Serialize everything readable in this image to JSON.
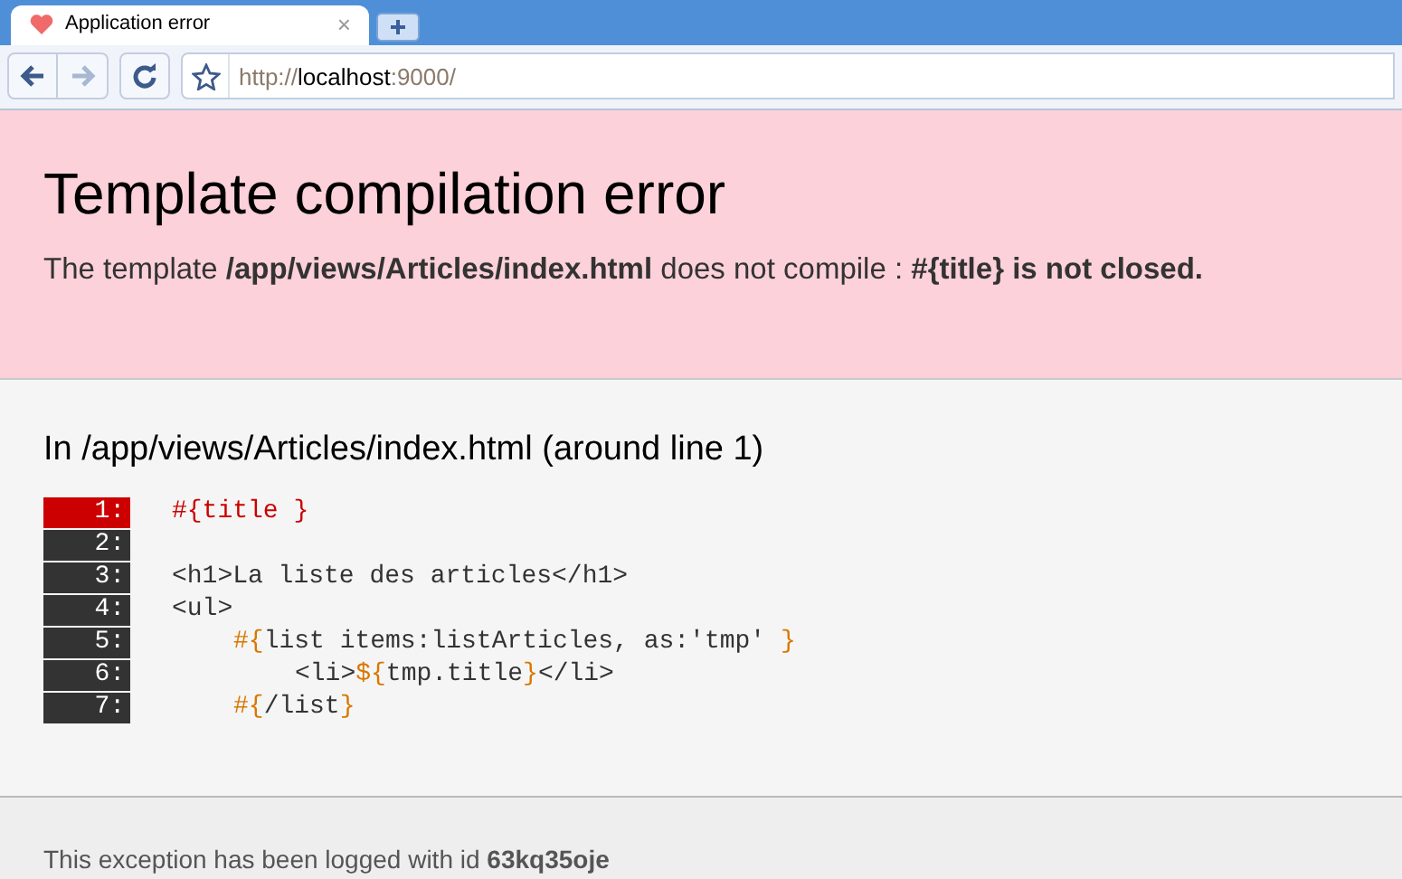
{
  "tab": {
    "title": "Application error",
    "close": "×",
    "selected": true
  },
  "url": [
    {
      "kind": "dim",
      "text": "http://"
    },
    {
      "kind": "host",
      "text": "localhost"
    },
    {
      "kind": "dim",
      "text": ":9000/"
    }
  ],
  "header": {
    "title": "Template compilation error",
    "message": "The template **/app/views/Articles/index.html** does not compile : **#{title} is not closed.**"
  },
  "source": {
    "title": "In /app/views/Articles/index.html (around line 1)",
    "lines": [
      {
        "number": "1:",
        "error": true,
        "segments": [
          {
            "kind": "tag",
            "text": "#{title }"
          }
        ]
      },
      {
        "number": "2:",
        "error": false
      },
      {
        "number": "3:",
        "error": false,
        "segments": [
          {
            "kind": "text",
            "text": "<h1>La liste des articles</h1>"
          }
        ]
      },
      {
        "number": "4:",
        "error": false,
        "segments": [
          {
            "kind": "text",
            "text": "<ul>"
          }
        ],
        "children": [
          {
            "number": "5:",
            "error": false,
            "segments": [
              {
                "kind": "tag",
                "text": "#{"
              },
              {
                "kind": "text",
                "text": "list items:listArticles, as:'tmp' "
              },
              {
                "kind": "tag",
                "text": "}"
              }
            ],
            "children": [
              {
                "number": "6:",
                "error": false,
                "segments": [
                  {
                    "kind": "text",
                    "text": "<li>"
                  },
                  {
                    "kind": "tag",
                    "text": "${"
                  },
                  {
                    "kind": "text",
                    "text": "tmp.title"
                  },
                  {
                    "kind": "tag",
                    "text": "}"
                  },
                  {
                    "kind": "text",
                    "text": "</li>"
                  }
                ]
              }
            ]
          },
          {
            "number": "7:",
            "error": false,
            "segments": [
              {
                "kind": "tag",
                "text": "#{"
              },
              {
                "kind": "text",
                "text": "/list"
              },
              {
                "kind": "tag",
                "text": "}"
              }
            ]
          }
        ]
      }
    ]
  },
  "footer": {
    "message": "This exception has been logged with id **63kq35oje**"
  }
}
